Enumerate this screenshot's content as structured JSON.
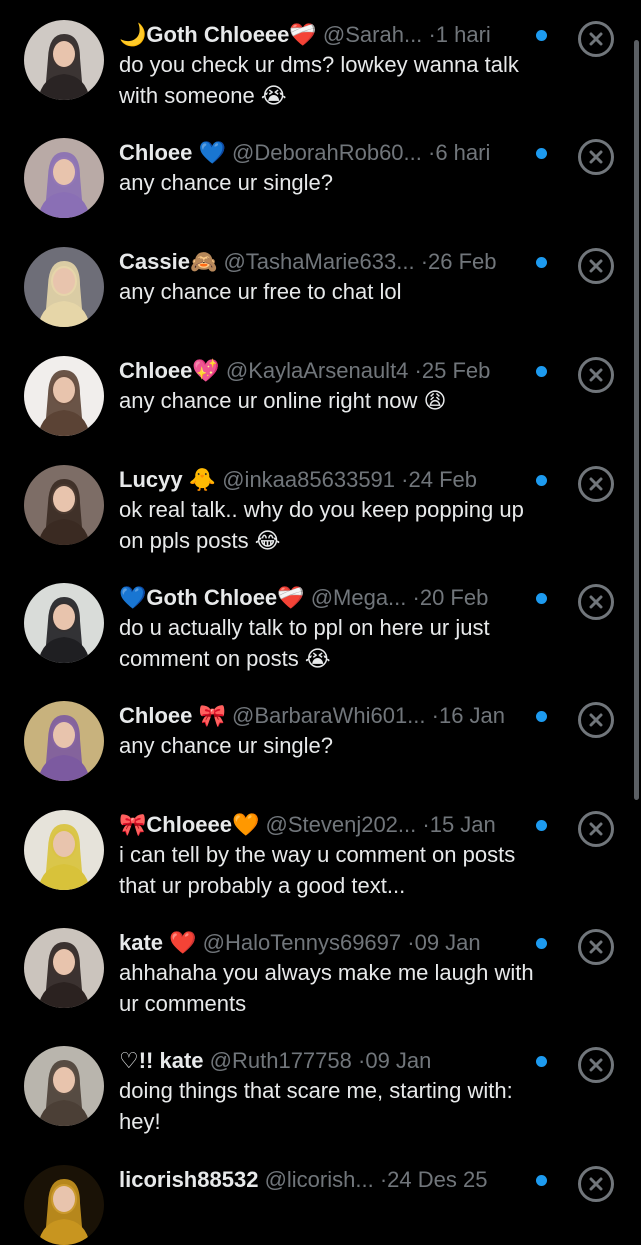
{
  "notifications": [
    {
      "name": "🌙Goth Chloeee❤️‍🩹",
      "handle": "@Sarah...",
      "time": "1 hari",
      "text": "do you check ur dms? lowkey wanna talk with someone 😭",
      "avatar_bg": "#cfc9c4",
      "avatar_fg": "#2a2424"
    },
    {
      "name": "Chloee 💙",
      "handle": "@DeborahRob60...",
      "time": "6 hari",
      "text": "any chance ur single?",
      "avatar_bg": "#b9aaa6",
      "avatar_fg": "#8a6fb5"
    },
    {
      "name": "Cassie🙈",
      "handle": "@TashaMarie633...",
      "time": "26 Feb",
      "text": "any chance ur free to chat lol",
      "avatar_bg": "#6e6e78",
      "avatar_fg": "#e6d6a8"
    },
    {
      "name": "Chloee💖",
      "handle": "@KaylaArsenault4",
      "time": "25 Feb",
      "text": "any chance ur online right now 😩",
      "avatar_bg": "#f1eeec",
      "avatar_fg": "#5b4335"
    },
    {
      "name": "Lucyy 🐥",
      "handle": "@inkaa85633591",
      "time": "24 Feb",
      "text": "ok real talk.. why do you keep popping up on ppls posts 😂",
      "avatar_bg": "#7d6d66",
      "avatar_fg": "#3a2a22"
    },
    {
      "name": "💙Goth Chloee❤️‍🩹",
      "handle": "@Mega...",
      "time": "20 Feb",
      "text": "do u actually talk to ppl on here ur just comment on posts 😭",
      "avatar_bg": "#d9dcd9",
      "avatar_fg": "#1f1f22"
    },
    {
      "name": "Chloee 🎀",
      "handle": "@BarbaraWhi601...",
      "time": "16 Jan",
      "text": "any chance ur single?",
      "avatar_bg": "#c8b27d",
      "avatar_fg": "#7c5aa0"
    },
    {
      "name": "🎀Chloeee🧡",
      "handle": "@Stevenj202...",
      "time": "15 Jan",
      "text": "i can tell by the way u comment on posts that ur probably a good text...",
      "avatar_bg": "#e6e3da",
      "avatar_fg": "#d8c23a"
    },
    {
      "name": "kate ❤️",
      "handle": "@HaloTennys69697",
      "time": "09 Jan",
      "text": "ahhahaha you always make me laugh with ur comments",
      "avatar_bg": "#cbc4bd",
      "avatar_fg": "#2b2220"
    },
    {
      "name": "♡!! kate",
      "handle": "@Ruth177758",
      "time": "09 Jan",
      "text": "doing things that scare me, starting with: hey!",
      "avatar_bg": "#b9b5ad",
      "avatar_fg": "#4b3f36"
    },
    {
      "name": "licorish88532",
      "handle": "@licorish...",
      "time": "24 Des 25",
      "text": "",
      "avatar_bg": "#1a1206",
      "avatar_fg": "#c8951f"
    }
  ]
}
